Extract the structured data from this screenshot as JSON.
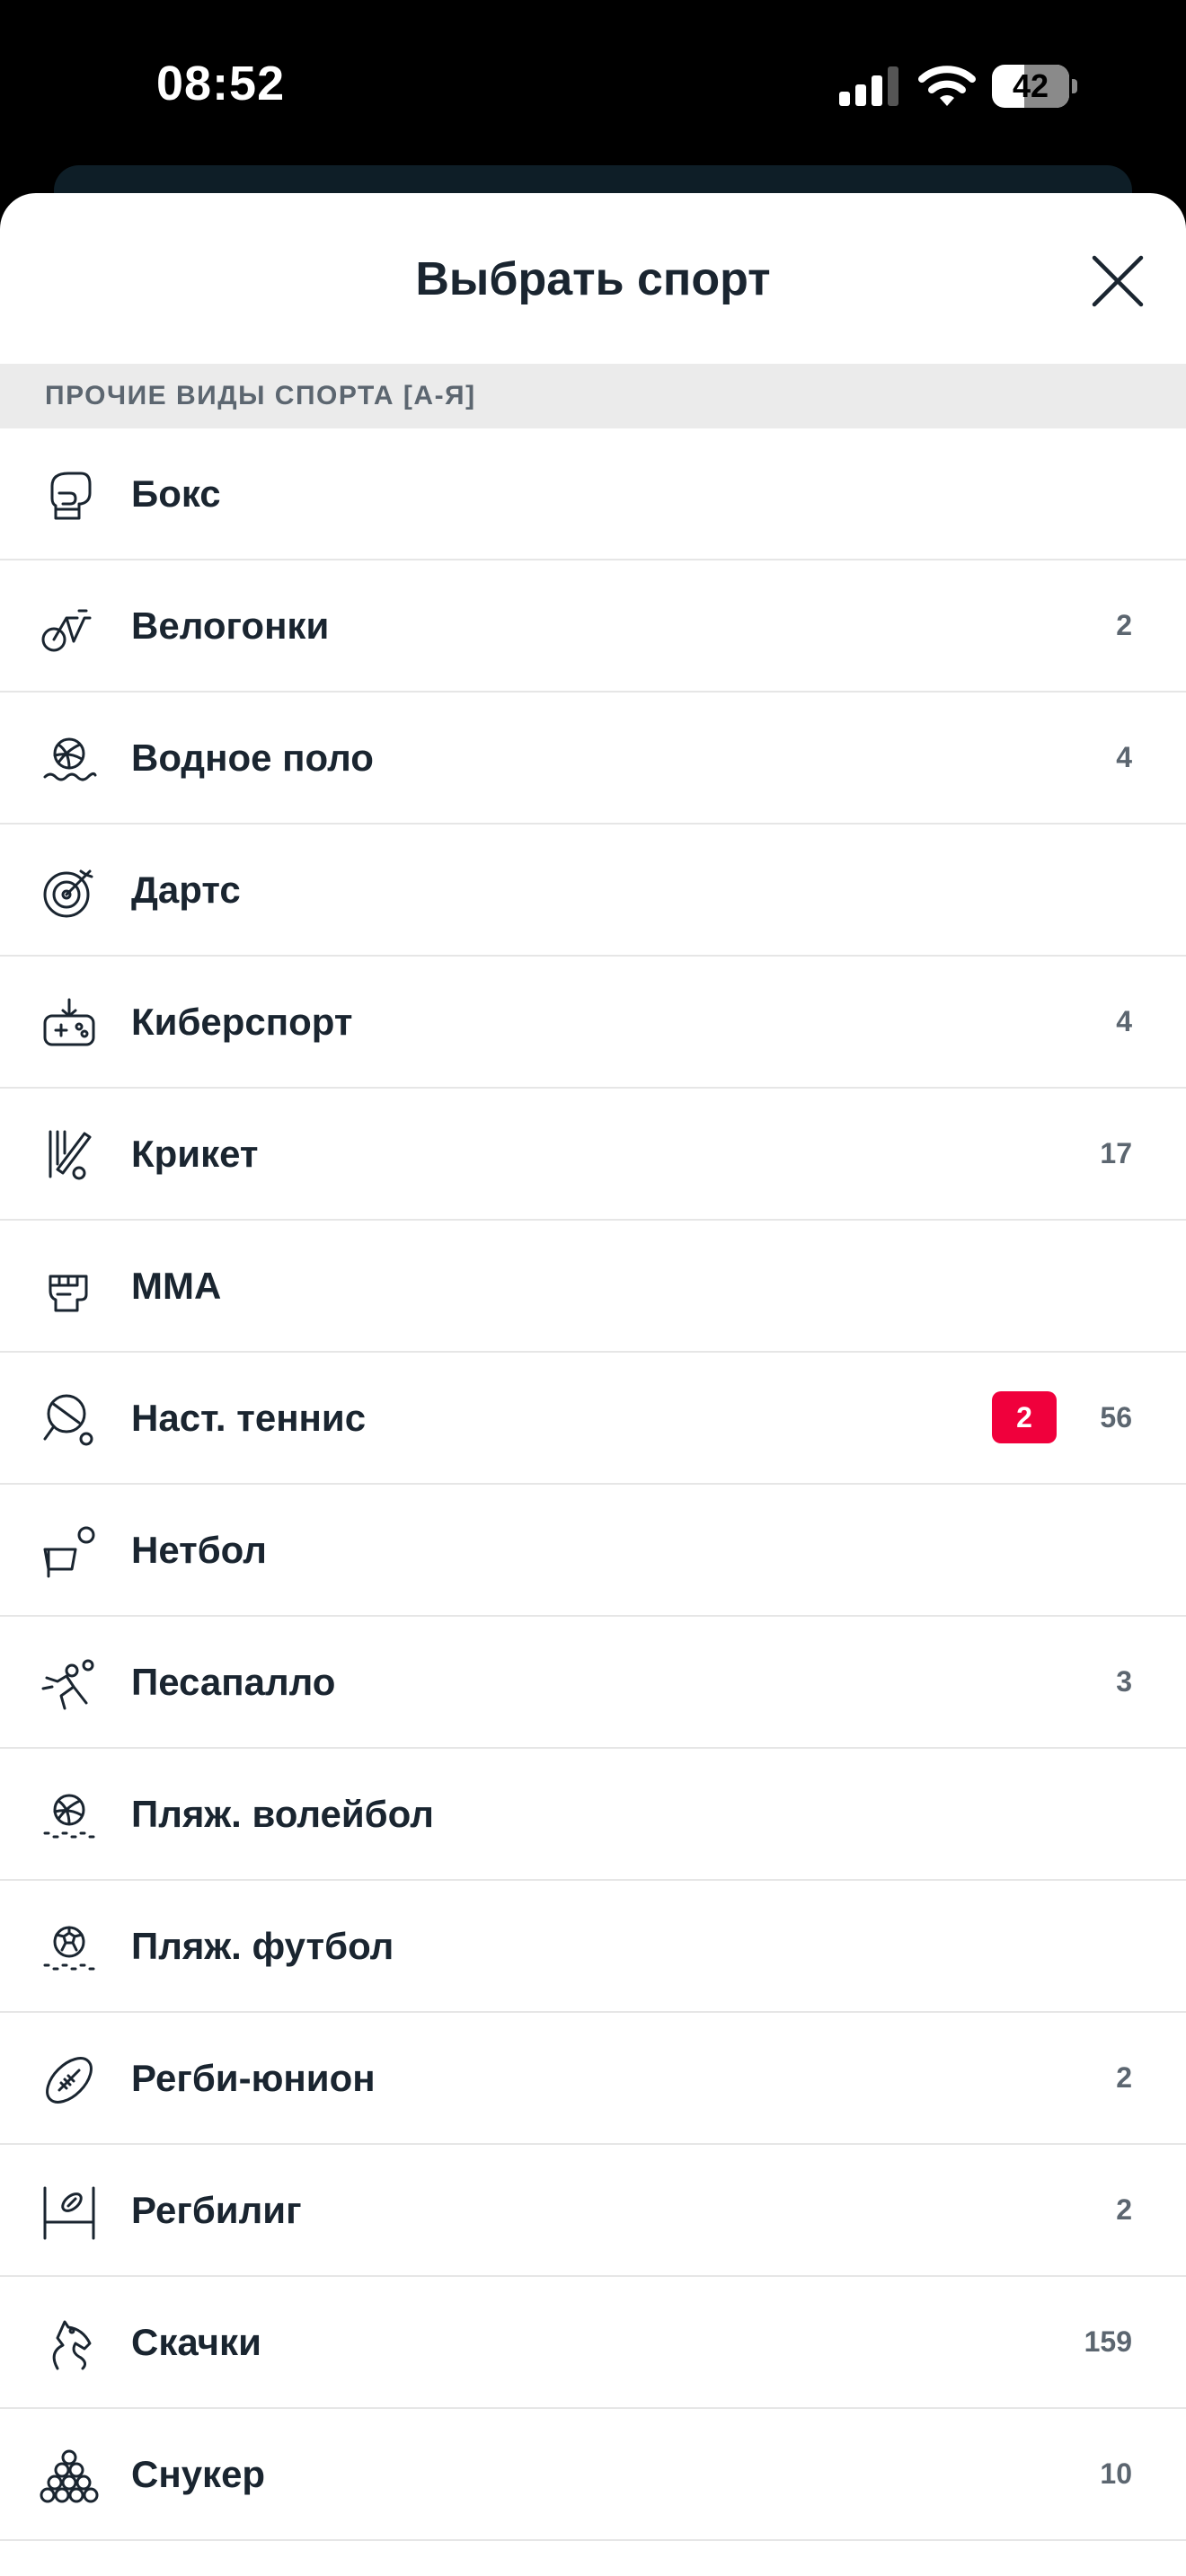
{
  "status_bar": {
    "time": "08:52",
    "battery": "42",
    "battery_level": 0.42
  },
  "sheet": {
    "title": "Выбрать спорт",
    "close_icon": "close-icon",
    "section_title": "ПРОЧИЕ ВИДЫ СПОРТА [А-Я]"
  },
  "sports": [
    {
      "label": "Бокс",
      "count": "",
      "live": "",
      "icon": "boxing-glove-icon"
    },
    {
      "label": "Велогонки",
      "count": "2",
      "live": "",
      "icon": "cycling-icon"
    },
    {
      "label": "Водное поло",
      "count": "4",
      "live": "",
      "icon": "water-polo-icon"
    },
    {
      "label": "Дартс",
      "count": "",
      "live": "",
      "icon": "darts-icon"
    },
    {
      "label": "Киберспорт",
      "count": "4",
      "live": "",
      "icon": "gamepad-icon"
    },
    {
      "label": "Крикет",
      "count": "17",
      "live": "",
      "icon": "cricket-icon"
    },
    {
      "label": "MMA",
      "count": "",
      "live": "",
      "icon": "fist-icon"
    },
    {
      "label": "Наст. теннис",
      "count": "56",
      "live": "2",
      "icon": "table-tennis-icon"
    },
    {
      "label": "Нетбол",
      "count": "",
      "live": "",
      "icon": "netball-icon"
    },
    {
      "label": "Песапалло",
      "count": "3",
      "live": "",
      "icon": "pesapallo-icon"
    },
    {
      "label": "Пляж. волейбол",
      "count": "",
      "live": "",
      "icon": "beach-volleyball-icon"
    },
    {
      "label": "Пляж. футбол",
      "count": "",
      "live": "",
      "icon": "beach-soccer-icon"
    },
    {
      "label": "Регби-юнион",
      "count": "2",
      "live": "",
      "icon": "rugby-ball-icon"
    },
    {
      "label": "Регбилиг",
      "count": "2",
      "live": "",
      "icon": "rugby-posts-icon"
    },
    {
      "label": "Скачки",
      "count": "159",
      "live": "",
      "icon": "horse-icon"
    },
    {
      "label": "Снукер",
      "count": "10",
      "live": "",
      "icon": "snooker-balls-icon"
    }
  ],
  "colors": {
    "accent_live": "#f0003c",
    "text": "#1a2530",
    "muted": "#5c6670",
    "section_bg": "#ebebeb"
  }
}
